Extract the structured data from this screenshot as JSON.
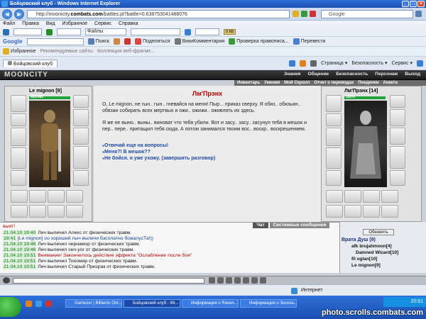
{
  "window": {
    "title": "Бойцовский клуб - Windows Internet Explorer"
  },
  "address": {
    "url_prefix": "http://moonicity.",
    "url_domain": "combats.com",
    "url_rest": "/battles.pl?battle=0.638753041488076",
    "search_label": "Google"
  },
  "menu": [
    "Файл",
    "Правка",
    "Вид",
    "Избранное",
    "Сервис",
    "Справка"
  ],
  "toolbar1": {
    "files_label": "Файлы",
    "kb_value": "0 КБ"
  },
  "toolbar2": {
    "google": "Google",
    "search": "Поиск",
    "share": "Поделиться",
    "wiki": "ВикиКомментарии",
    "spell": "Проверка правописа...",
    "translate": "Перевести"
  },
  "favorites": {
    "label": "Избранное",
    "recommended": "Рекомендуемые сайты",
    "gallery": "Коллекция веб-фрагме..."
  },
  "tabs": {
    "current": "Бойцовский клуб",
    "page": "Страница",
    "security": "Безопасность",
    "service": "Сервис"
  },
  "game": {
    "logo": "MOONCITY",
    "topnav": [
      "Знания",
      "Общение",
      "Безопасность",
      "Персонаж",
      "Выход"
    ],
    "subnav": [
      "Инвентарь",
      "Умения",
      "Мой Скролл",
      "Отчет о переводах",
      "Поединки",
      "Анкета"
    ],
    "player": {
      "name": "Le mignon",
      "level": "[9]",
      "hp": "480/480"
    },
    "npc": {
      "name": "Лм'Прэнх",
      "level": "[14]",
      "hp": "100%"
    }
  },
  "dialog": {
    "npc_title": "Лм'Прэнх",
    "p1": "О, Le mignon, не гын.. гын.. гневайся на меня! Пыр... приказ сверху. Я обяз.. обязьян.. обязан собирать всех мертвых и ожи.. ожижи.. оживлять их здесь.",
    "p2": "Я же не выно.. выны.. виноват что тебя убили. Вот и засу.. засу.. засунул тебя в мешок и пер.. пере.. притащил тебя сюда. А потом занимался твоим вос.. воскр.. воскрешением.",
    "options": [
      "Отвечай еще на вопросы!",
      "Меня?! В мешок??",
      "Не бойся. я уже ухожу. (завершить разговор)"
    ]
  },
  "chat": {
    "tab_chat": "Чат",
    "tab_system": "Системные сообщения",
    "first": "выят!",
    "lines": [
      {
        "ts": "21.04.10 19:40",
        "text": "Лич вылечил Алекс от физических травм."
      },
      {
        "ts": "19:41",
        "text": "[Le mignon] оо хороший лыч вылечи бэсплатно божалусТа!))"
      },
      {
        "ts": "21.04.10 19:46",
        "text": "Лич вылечил чернамор от физических травм."
      },
      {
        "ts": "21.04.10 19:46",
        "text": "Лич вылечил sen-yor от физических травм."
      },
      {
        "ts": "21.04.10 19:51",
        "text": "Внимание! Закончилось действие эффекта \"Ослабление после боя\""
      },
      {
        "ts": "21.04.10 19:51",
        "text": "Лич вылечил Тихомир от физических травм."
      },
      {
        "ts": "21.04.10 19:51",
        "text": "Лич вылечил Старый Призрак от физических травм."
      }
    ]
  },
  "room": {
    "refresh": "Обновить",
    "title": "Врата Душ (9)",
    "users": [
      "afk brujahmoon[4]",
      "Damned Wizard[10]",
      "fil oglan[10]",
      "Le mignon[9]"
    ]
  },
  "status": {
    "zone": "Интернет"
  },
  "taskbar": {
    "tasks": [
      "Gamezer | Billiards Onl...",
      "Бойцовский клуб - Wi...",
      "Информация о Raven...",
      "Информация о Зосеза..."
    ],
    "time": "20:51"
  },
  "watermark": "photo.scrolls.combats.com"
}
